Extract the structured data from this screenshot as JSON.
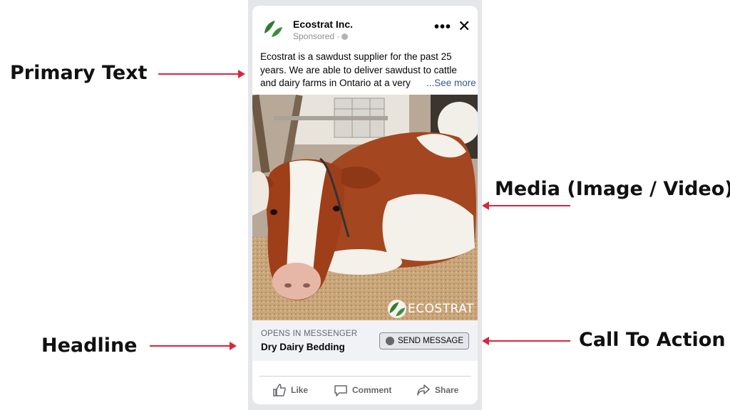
{
  "annotations": {
    "primary_text": "Primary Text",
    "media": "Media (Image / Video)",
    "headline": "Headline",
    "call_to_action": "Call To Action"
  },
  "ad": {
    "company": "Ecostrat Inc.",
    "sponsored": "Sponsored ·",
    "more_icon": "more-icon",
    "close_icon": "close-icon",
    "primary_text": "Ecostrat is a sawdust supplier for the past 25 years. We are able to deliver sawdust to cattle and dairy farms in Ontario at a very",
    "see_more": "...See more",
    "media_alt": "cow lying on sawdust bedding",
    "watermark": "ECOSTRAT",
    "opens_in": "OPENS IN MESSENGER",
    "headline": "Dry Dairy Bedding",
    "cta_label": "SEND MESSAGE",
    "actions": [
      "Like",
      "Comment",
      "Share"
    ]
  },
  "colors": {
    "arrow": "#d7263d",
    "link": "#385898",
    "brand_green": "#2e7d32"
  }
}
